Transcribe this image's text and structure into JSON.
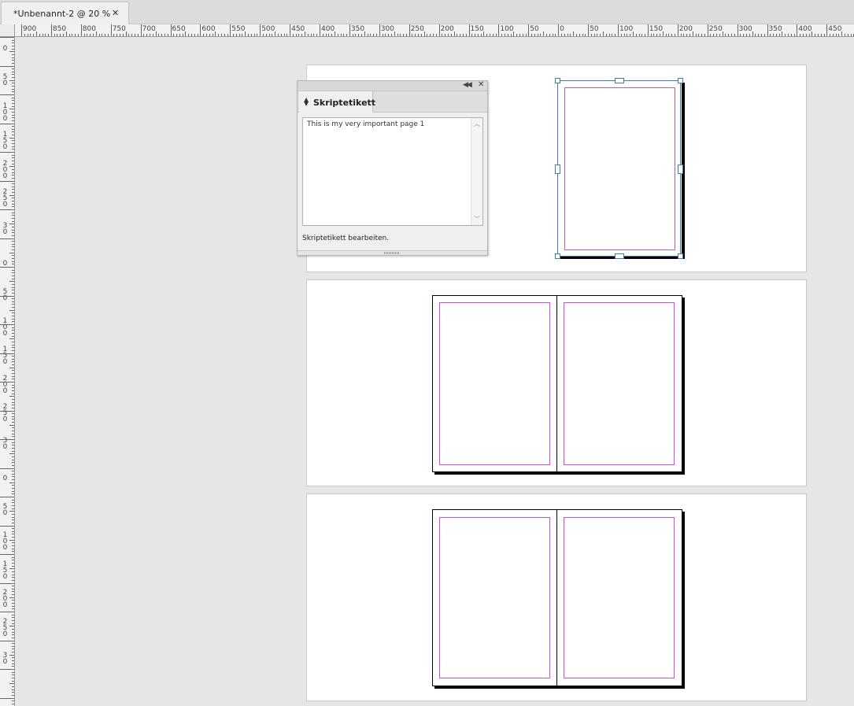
{
  "document_tab": {
    "title": "*Unbenannt-2 @ 20 %",
    "close_glyph": "✕"
  },
  "horizontal_ruler": {
    "labels": [
      "900",
      "850",
      "800",
      "750",
      "700",
      "650",
      "600",
      "550",
      "500",
      "450",
      "400",
      "350",
      "300",
      "250",
      "200",
      "150",
      "100",
      "50",
      "0",
      "50",
      "100",
      "150",
      "200",
      "250",
      "300",
      "350",
      "400",
      "450"
    ]
  },
  "vertical_ruler": {
    "labels": [
      "0",
      "0",
      "50",
      "100",
      "150",
      "200",
      "250",
      "30",
      "0",
      "50",
      "100",
      "150",
      "200",
      "250",
      "30",
      "0",
      "50",
      "100",
      "150",
      "200",
      "250",
      "30"
    ]
  },
  "script_label_panel": {
    "tab_title": "Skriptetikett",
    "label_text": "This is my very important page 1",
    "hint": "Skriptetikett bearbeiten.",
    "icons": [
      "collapse-icon",
      "close-icon",
      "tab-arrows-icon"
    ]
  },
  "colors": {
    "margin_guide": "#c94fd6",
    "selection": "#3a7fb0",
    "pasteboard": "#e6e6e6"
  }
}
